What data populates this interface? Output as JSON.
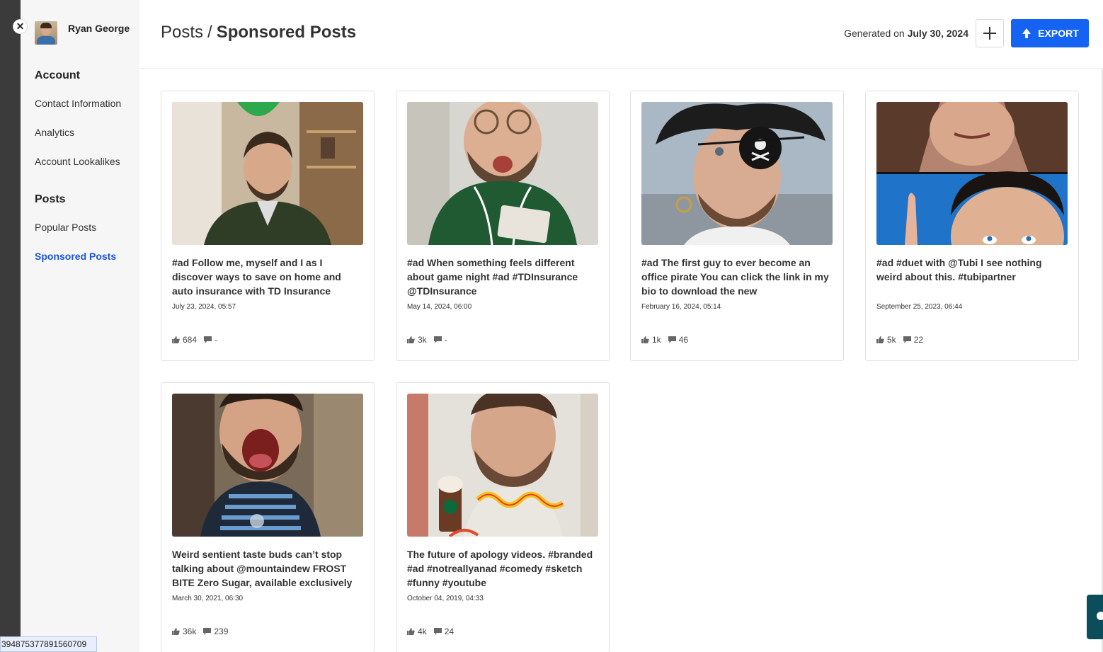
{
  "profile": {
    "name": "Ryan George"
  },
  "sidebar": {
    "account_heading": "Account",
    "account_items": [
      "Contact Information",
      "Analytics",
      "Account Lookalikes"
    ],
    "posts_heading": "Posts",
    "posts_items": [
      "Popular Posts",
      "Sponsored Posts"
    ],
    "active": "Sponsored Posts"
  },
  "header": {
    "breadcrumb_root": "Posts",
    "breadcrumb_sep": "/",
    "breadcrumb_current": "Sponsored Posts",
    "generated_prefix": "Generated on",
    "generated_date": "July 30, 2024",
    "export_label": "EXPORT"
  },
  "posts": [
    {
      "caption": "#ad Follow me, myself and I as I discover ways to save on home and auto insurance with TD Insurance without even knowing …",
      "date": "July 23, 2024, 05:57",
      "likes": "684",
      "comments": "-"
    },
    {
      "caption": "#ad When something feels different about game night #ad #TDInsurance @TDInsurance",
      "date": "May 14, 2024, 06:00",
      "likes": "3k",
      "comments": "-"
    },
    {
      "caption": "#ad The first guy to ever become an office pirate You can click the link in my bio to download the new @UbisoftCanada pirat…",
      "date": "February 16, 2024, 05:14",
      "likes": "1k",
      "comments": "46"
    },
    {
      "caption": "#ad #duet with @Tubi I see nothing weird about this. #tubipartner",
      "date": "September 25, 2023, 06:44",
      "likes": "5k",
      "comments": "22"
    },
    {
      "caption": "Weird sentient taste buds can’t stop talking about @mountaindew FROST BITE Zero Sugar, available exclusively at…",
      "date": "March 30, 2021, 06:30",
      "likes": "36k",
      "comments": "239"
    },
    {
      "caption": "The future of apology videos. #branded #ad #notreallyanad #comedy #sketch #funny #youtube",
      "date": "October 04, 2019, 04:33",
      "likes": "4k",
      "comments": "24"
    }
  ],
  "footer": {
    "id_tag": "394875377891560709"
  },
  "icons": {
    "close": "close-icon",
    "plus": "plus-icon",
    "export": "export-icon",
    "like": "thumbs-up-icon",
    "comment": "comment-icon",
    "chat": "chat-icon"
  },
  "colors": {
    "accent": "#1463f3",
    "active_nav": "#1a56db",
    "sidebar_bg": "#f6f6f6"
  }
}
